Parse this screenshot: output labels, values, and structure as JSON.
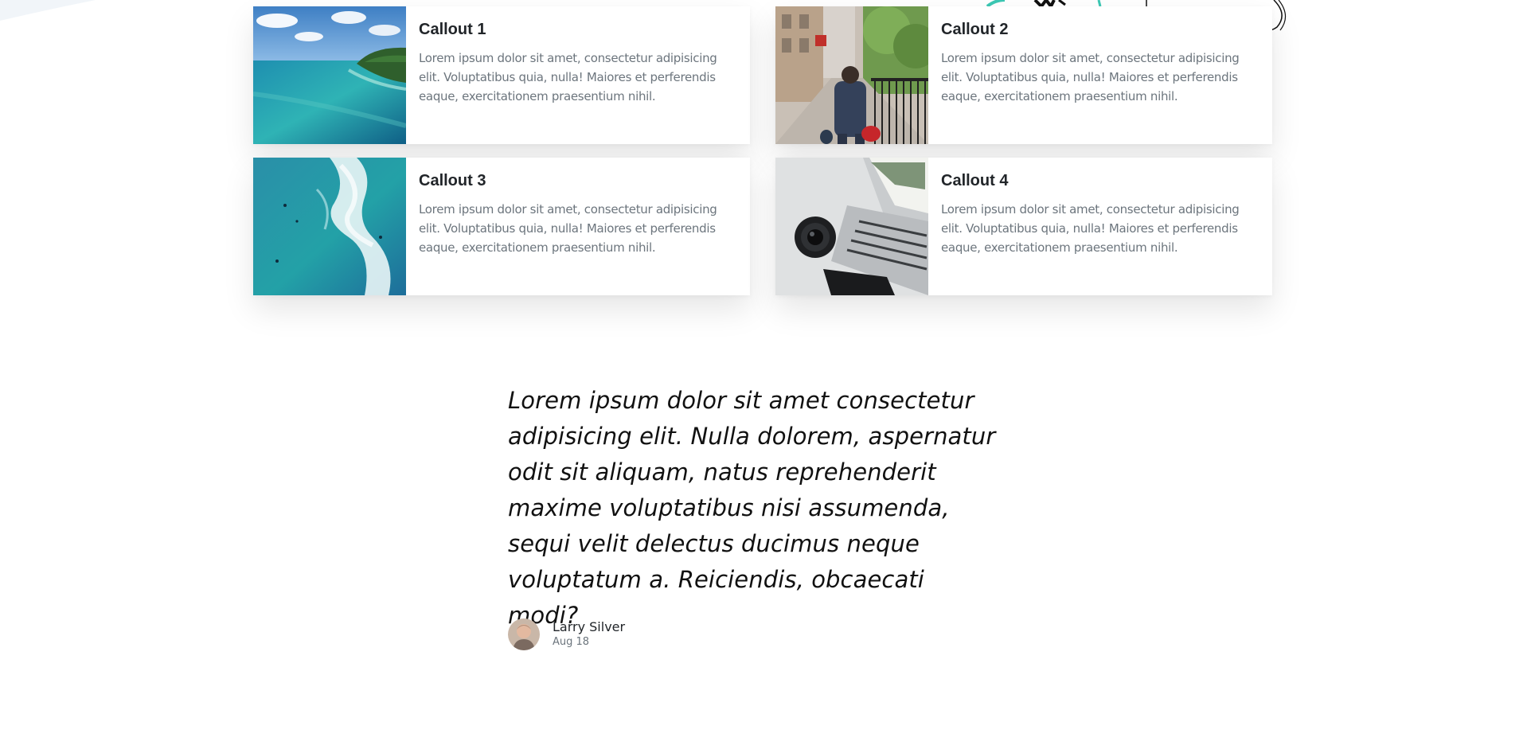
{
  "callouts": [
    {
      "title": "Callout 1",
      "text": "Lorem ipsum dolor sit amet, consectetur adipisicing elit. Voluptatibus quia, nulla! Maiores et perferendis eaque, exercitationem praesentium nihil.",
      "image": "beach-island-photo"
    },
    {
      "title": "Callout 2",
      "text": "Lorem ipsum dolor sit amet, consectetur adipisicing elit. Voluptatibus quia, nulla! Maiores et perferendis eaque, exercitationem praesentium nihil.",
      "image": "city-sidewalk-photo"
    },
    {
      "title": "Callout 3",
      "text": "Lorem ipsum dolor sit amet, consectetur adipisicing elit. Voluptatibus quia, nulla! Maiores et perferendis eaque, exercitationem praesentium nihil.",
      "image": "ocean-waves-aerial-photo"
    },
    {
      "title": "Callout 4",
      "text": "Lorem ipsum dolor sit amet, consectetur adipisicing elit. Voluptatibus quia, nulla! Maiores et perferendis eaque, exercitationem praesentium nihil.",
      "image": "laptop-desk-photo"
    }
  ],
  "testimonial": {
    "quote": "Lorem ipsum dolor sit amet consectetur adipisicing elit. Nulla dolorem, aspernatur odit sit aliquam, natus reprehenderit maxime voluptatibus nisi assumenda, sequi velit delectus ducimus neque voluptatum a. Reiciendis, obcaecati modi?",
    "author_name": "Larry Silver",
    "author_date": "Aug 18"
  },
  "colors": {
    "text_dark": "#212529",
    "text_muted": "#6c757d",
    "background": "#ffffff",
    "doodle_accent": "#3cc8b4"
  }
}
